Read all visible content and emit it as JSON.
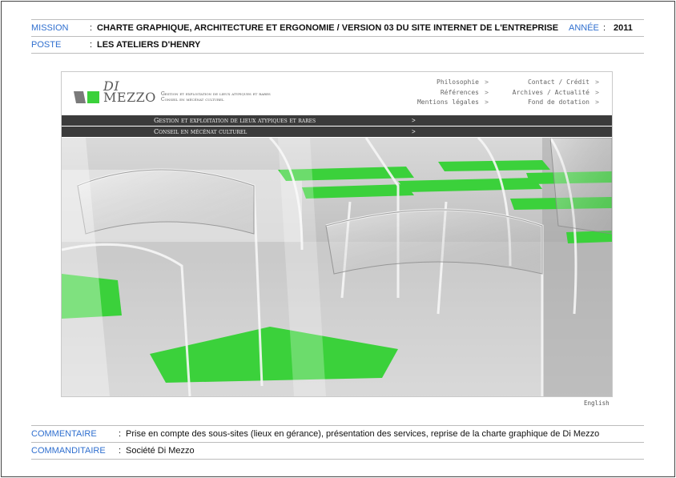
{
  "header": {
    "mission_label": "MISSION",
    "mission_value": "CHARTE GRAPHIQUE, ARCHITECTURE ET ERGONOMIE / VERSION 03 DU SITE INTERNET DE L'ENTREPRISE",
    "year_label": "ANNÉE",
    "year_value": "2011",
    "poste_label": "POSTE",
    "poste_value": "LES ATELIERS D'HENRY",
    "separator": ":"
  },
  "site": {
    "logo_line1": "DI",
    "logo_line2": "MEZZO",
    "tagline1": "Gestion et exploitation de lieux atypiques et rares",
    "tagline2": "Conseil en mécénat culturel",
    "nav_left": [
      "Philosophie",
      "Références",
      "Mentions légales"
    ],
    "nav_right": [
      "Contact / Crédit",
      "Archives / Actualité",
      "Fond de dotation"
    ],
    "chevron": ">",
    "menu1": "Gestion et exploitation de lieux atypiques et rares",
    "menu2": "Conseil en mécénat culturel",
    "language": "English",
    "colors": {
      "accent_green": "#3bd13b",
      "bar": "#3b3b3b"
    }
  },
  "footer": {
    "comment_label": "COMMENTAIRE",
    "comment_value": "Prise en compte des sous-sites (lieux en gérance), présentation des services, reprise de la charte graphique de Di Mezzo",
    "client_label": "COMMANDITAIRE",
    "client_value": "Société Di Mezzo",
    "separator": ":"
  }
}
